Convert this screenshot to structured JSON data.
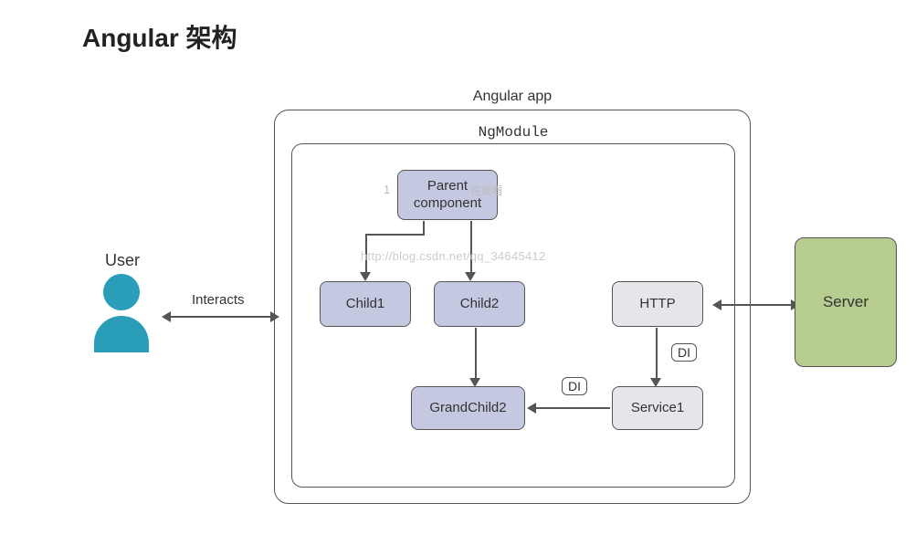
{
  "title": "Angular 架构",
  "user": {
    "label": "User"
  },
  "interactsLabel": "Interacts",
  "app": {
    "label": "Angular app"
  },
  "module": {
    "label": "NgModule"
  },
  "nodes": {
    "parent": "Parent component",
    "child1": "Child1",
    "child2": "Child2",
    "grandchild2": "GrandChild2",
    "http": "HTTP",
    "service1": "Service1"
  },
  "di": {
    "label1": "DI",
    "label2": "DI"
  },
  "server": {
    "label": "Server"
  },
  "watermarks": {
    "num": "1",
    "top": "在观看",
    "url": "http://blog.csdn.net/qq_34645412"
  }
}
